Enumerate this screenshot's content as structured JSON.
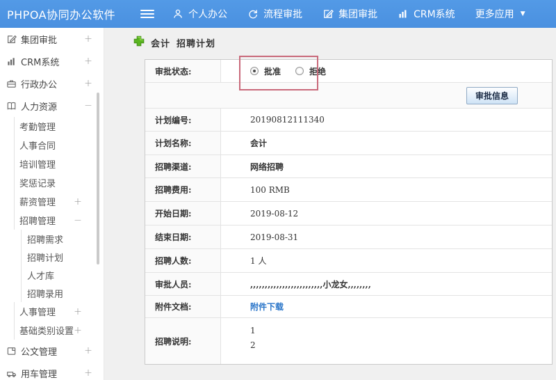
{
  "topbar": {
    "logo": "PHPOA协同办公软件",
    "nav": [
      {
        "label": "个人办公",
        "icon": "person-icon"
      },
      {
        "label": "流程审批",
        "icon": "flow-icon"
      },
      {
        "label": "集团审批",
        "icon": "edit-square-icon"
      },
      {
        "label": "CRM系统",
        "icon": "bar-chart-icon"
      },
      {
        "label": "更多应用",
        "icon": "caret-down-icon"
      }
    ],
    "bg_color": "#4a90e0"
  },
  "sidebar": {
    "items": [
      {
        "label": "集团审批",
        "icon": "edit-square-icon",
        "expand": "+",
        "level": 0
      },
      {
        "label": "CRM系统",
        "icon": "bar-chart-icon",
        "expand": "+",
        "level": 0
      },
      {
        "label": "行政办公",
        "icon": "briefcase-icon",
        "expand": "+",
        "level": 0
      },
      {
        "label": "人力资源",
        "icon": "book-icon",
        "expand": "−",
        "level": 0
      },
      {
        "label": "考勤管理",
        "level": 1
      },
      {
        "label": "人事合同",
        "level": 1
      },
      {
        "label": "培训管理",
        "level": 1
      },
      {
        "label": "奖惩记录",
        "level": 1
      },
      {
        "label": "薪资管理",
        "expand": "+",
        "level": 1
      },
      {
        "label": "招聘管理",
        "expand": "−",
        "level": 1
      },
      {
        "label": "招聘需求",
        "level": 2
      },
      {
        "label": "招聘计划",
        "level": 2
      },
      {
        "label": "人才库",
        "level": 2
      },
      {
        "label": "招聘录用",
        "level": 2
      },
      {
        "label": "人事管理",
        "expand": "+",
        "level": 1
      },
      {
        "label": "基础类别设置",
        "expand": "+",
        "level": 1
      },
      {
        "label": "公文管理",
        "icon": "document-icon",
        "expand": "+",
        "level": 0
      },
      {
        "label": "用车管理",
        "icon": "car-icon",
        "expand": "+",
        "level": 0
      }
    ]
  },
  "page": {
    "title_primary": "会计",
    "title_secondary": "招聘计划"
  },
  "form": {
    "status_label": "审批状态:",
    "radio_approve": "批准",
    "radio_reject": "拒绝",
    "approve_info_button": "审批信息",
    "fields": [
      {
        "label": "计划编号:",
        "value": "20190812111340"
      },
      {
        "label": "计划名称:",
        "value": "会计"
      },
      {
        "label": "招聘渠道:",
        "value": "网络招聘"
      },
      {
        "label": "招聘费用:",
        "value": "100 RMB"
      },
      {
        "label": "开始日期:",
        "value": "2019-08-12"
      },
      {
        "label": "结束日期:",
        "value": "2019-08-31"
      },
      {
        "label": "招聘人数:",
        "value": "1 人"
      },
      {
        "label": "审批人员:",
        "value": ",,,,,,,,,,,,,,,,,,,,,,,,,小龙女,,,,,,,,"
      }
    ],
    "attachment_label": "附件文档:",
    "attachment_link": "附件下载",
    "description_label": "招聘说明:",
    "description_lines": [
      "1",
      "2"
    ]
  },
  "colors": {
    "topbar_blue": "#4a90e0",
    "annotation_red": "#c9697a",
    "link_blue": "#2b76c9",
    "title_plus_green": "#58b21f"
  }
}
